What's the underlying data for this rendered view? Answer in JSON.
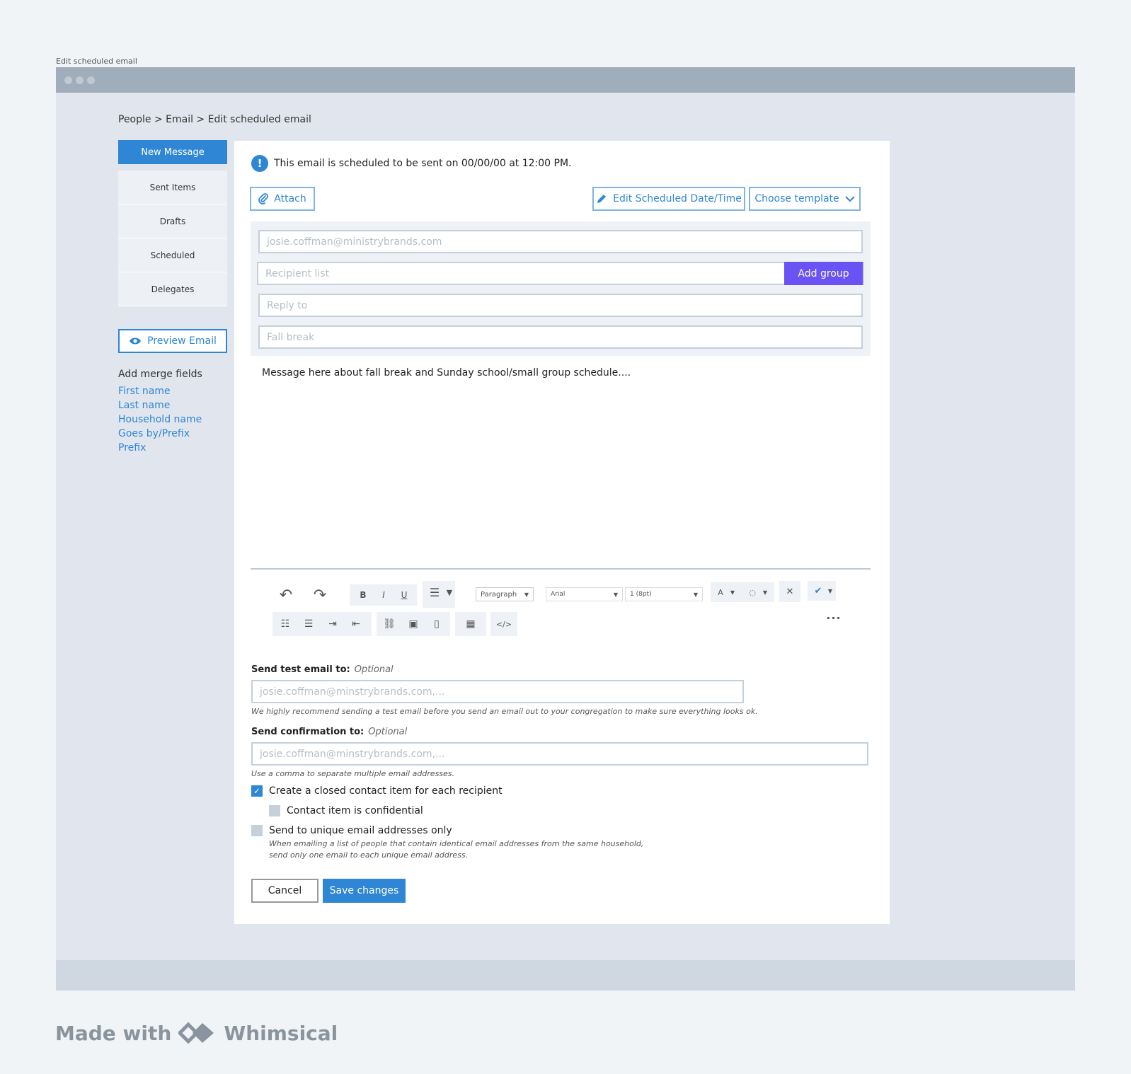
{
  "frame_title": "Edit scheduled email",
  "breadcrumb": "People > Email > Edit scheduled email",
  "sidebar": {
    "new_message": "New Message",
    "nav": [
      "Sent Items",
      "Drafts",
      "Scheduled",
      "Delegates"
    ],
    "preview": "Preview Email",
    "merge_title": "Add merge fields",
    "merge_fields": [
      "First name",
      "Last name",
      "Household name",
      "Goes by/Prefix",
      "Prefix"
    ]
  },
  "notice": "This email is scheduled to be sent on 00/00/00 at 12:00 PM.",
  "toolbar": {
    "attach": "Attach",
    "edit_schedule": "Edit Scheduled Date/Time",
    "choose_template": "Choose template"
  },
  "fields": {
    "from_placeholder": "josie.coffman@ministrybrands.com",
    "recipient_placeholder": "Recipient list",
    "add_group": "Add group",
    "reply_placeholder": "Reply to",
    "subject_placeholder": "Fall break"
  },
  "body_text": "Message here about fall break and Sunday school/small group schedule....",
  "editor": {
    "bold": "B",
    "italic": "I",
    "underline": "U",
    "block_format": "Paragraph",
    "font_family": "Arial",
    "font_size": "1 (8pt)",
    "font_color": "A",
    "more": "..."
  },
  "test_email": {
    "label": "Send test email to:",
    "optional": "Optional",
    "placeholder": "josie.coffman@minstrybrands.com,...",
    "hint": "We highly recommend sending a test email before you send an email out to your congregation to make sure everything looks ok."
  },
  "confirmation": {
    "label": "Send confirmation to:",
    "optional": "Optional",
    "placeholder": "josie.coffman@minstrybrands.com,...",
    "hint": "Use a comma to separate multiple email addresses."
  },
  "options": {
    "closed_contact": "Create a closed contact item for each recipient",
    "confidential": "Contact item is confidential",
    "unique": "Send to unique email addresses only",
    "unique_hint_1": "When emailing a list of people that contain identical email addresses from the same household,",
    "unique_hint_2": "send only one email to each unique email address."
  },
  "actions": {
    "cancel": "Cancel",
    "save": "Save changes"
  },
  "brand": {
    "made_with": "Made with",
    "name": "Whimsical"
  },
  "colors": {
    "primary": "#2e86d4",
    "accent": "#6b52f5"
  }
}
